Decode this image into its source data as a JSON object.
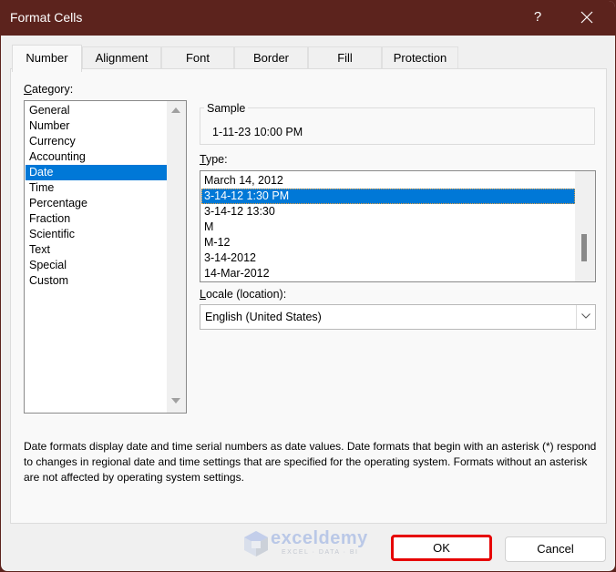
{
  "window": {
    "title": "Format Cells",
    "help_label": "?",
    "close_icon": "close-icon"
  },
  "tabs": [
    {
      "label": "Number",
      "active": true
    },
    {
      "label": "Alignment",
      "active": false
    },
    {
      "label": "Font",
      "active": false
    },
    {
      "label": "Border",
      "active": false
    },
    {
      "label": "Fill",
      "active": false
    },
    {
      "label": "Protection",
      "active": false
    }
  ],
  "category": {
    "label_accel": "C",
    "label_rest": "ategory:",
    "items": [
      "General",
      "Number",
      "Currency",
      "Accounting",
      "Date",
      "Time",
      "Percentage",
      "Fraction",
      "Scientific",
      "Text",
      "Special",
      "Custom"
    ],
    "selected": "Date"
  },
  "sample": {
    "legend": "Sample",
    "value": "1-11-23 10:00 PM"
  },
  "type": {
    "label_accel": "T",
    "label_rest": "ype:",
    "items": [
      "March 14, 2012",
      "3-14-12 1:30 PM",
      "3-14-12 13:30",
      "M",
      "M-12",
      "3-14-2012",
      "14-Mar-2012"
    ],
    "selected": "3-14-12 1:30 PM"
  },
  "locale": {
    "label_accel": "L",
    "label_rest": "ocale (location):",
    "value": "English (United States)"
  },
  "description": "Date formats display date and time serial numbers as date values.  Date formats that begin with an asterisk (*) respond to changes in regional date and time settings that are specified for the operating system. Formats without an asterisk are not affected by operating system settings.",
  "watermark": {
    "name": "exceldemy",
    "tagline": "EXCEL · DATA · BI"
  },
  "buttons": {
    "ok": "OK",
    "cancel": "Cancel"
  },
  "colors": {
    "titlebar": "#5c231d",
    "selection": "#0078d7",
    "ok_highlight": "#e60000"
  }
}
